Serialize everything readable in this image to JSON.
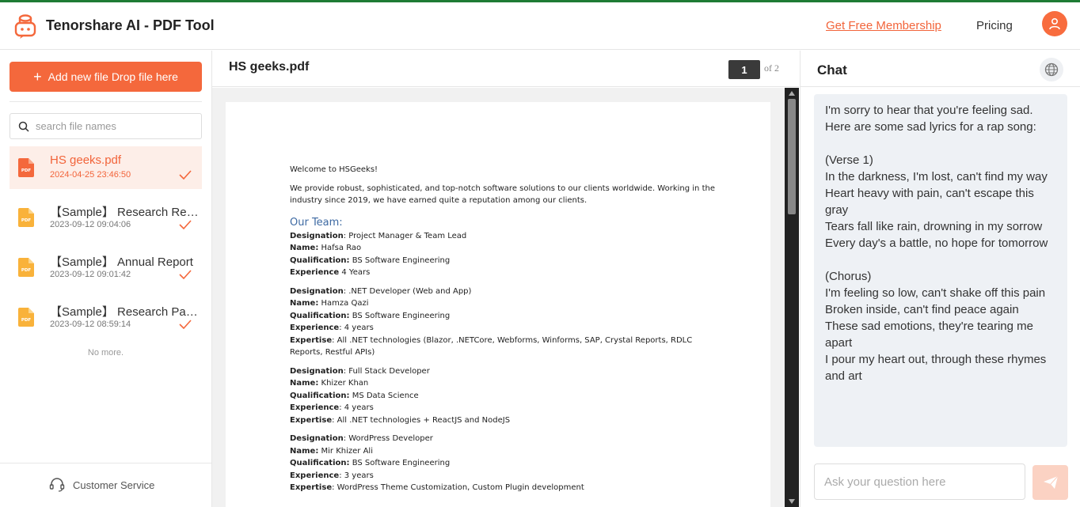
{
  "header": {
    "brand": "Tenorshare AI - PDF Tool",
    "membership_link": "Get Free Membership",
    "pricing_link": "Pricing"
  },
  "sidebar": {
    "add_button": "Add new file Drop file here",
    "search_placeholder": "search file names",
    "files": [
      {
        "name": "HS geeks.pdf",
        "date": "2024-04-25 23:46:50",
        "active": true
      },
      {
        "name": "【Sample】 Research Report on Chinese Consumer",
        "date": "2023-09-12 09:04:06",
        "active": false
      },
      {
        "name": "【Sample】 Annual Report",
        "date": "2023-09-12 09:01:42",
        "active": false
      },
      {
        "name": "【Sample】 Research Paper",
        "date": "2023-09-12 08:59:14",
        "active": false
      }
    ],
    "no_more": "No more.",
    "customer_service": "Customer Service"
  },
  "viewer": {
    "doc_name": "HS geeks.pdf",
    "current_page": "1",
    "page_total": "of 2",
    "content": {
      "welcome": "Welcome to HSGeeks!",
      "intro": "We provide robust, sophisticated, and top-notch software solutions to our clients worldwide. Working in the industry since 2019, we have earned quite a reputation among our clients.",
      "team_heading": "Our Team:",
      "members": [
        {
          "designation": "Project Manager & Team Lead",
          "name": "Hafsa Rao",
          "qualification": "BS Software Engineering",
          "experience": "4 Years"
        },
        {
          "designation": ".NET Developer (Web and App)",
          "name": "Hamza Qazi",
          "qualification": "BS Software Engineering",
          "experience": "4 years",
          "expertise": "All .NET technologies (Blazor, .NETCore, Webforms, Winforms, SAP, Crystal Reports, RDLC Reports, Restful APIs)"
        },
        {
          "designation": "Full Stack Developer",
          "name": "Khizer Khan",
          "qualification": "MS Data Science",
          "experience": "4 years",
          "expertise": "All .NET technologies + ReactJS and NodeJS"
        },
        {
          "designation": "WordPress Developer",
          "name": "Mir Khizer Ali",
          "qualification": "BS Software Engineering",
          "experience": "3 years",
          "expertise": "WordPress Theme Customization, Custom Plugin development"
        }
      ],
      "labels": {
        "designation": "Designation",
        "name": "Name:",
        "qualification": "Qualification:",
        "experience": "Experience",
        "expertise": "Expertise"
      }
    }
  },
  "chat": {
    "title": "Chat",
    "message": "I'm sorry to hear that you're feeling sad. Here are some sad lyrics for a rap song:\n\n(Verse 1)\nIn the darkness, I'm lost, can't find my way\nHeart heavy with pain, can't escape this gray\nTears fall like rain, drowning in my sorrow\nEvery day's a battle, no hope for tomorrow\n\n(Chorus)\nI'm feeling so low, can't shake off this pain\nBroken inside, can't find peace again\nThese sad emotions, they're tearing me apart\nI pour my heart out, through these rhymes and art",
    "input_placeholder": "Ask your question here"
  },
  "colors": {
    "accent": "#f4683c",
    "active_bg": "#fdeee8",
    "team_heading": "#3e6aa3"
  }
}
